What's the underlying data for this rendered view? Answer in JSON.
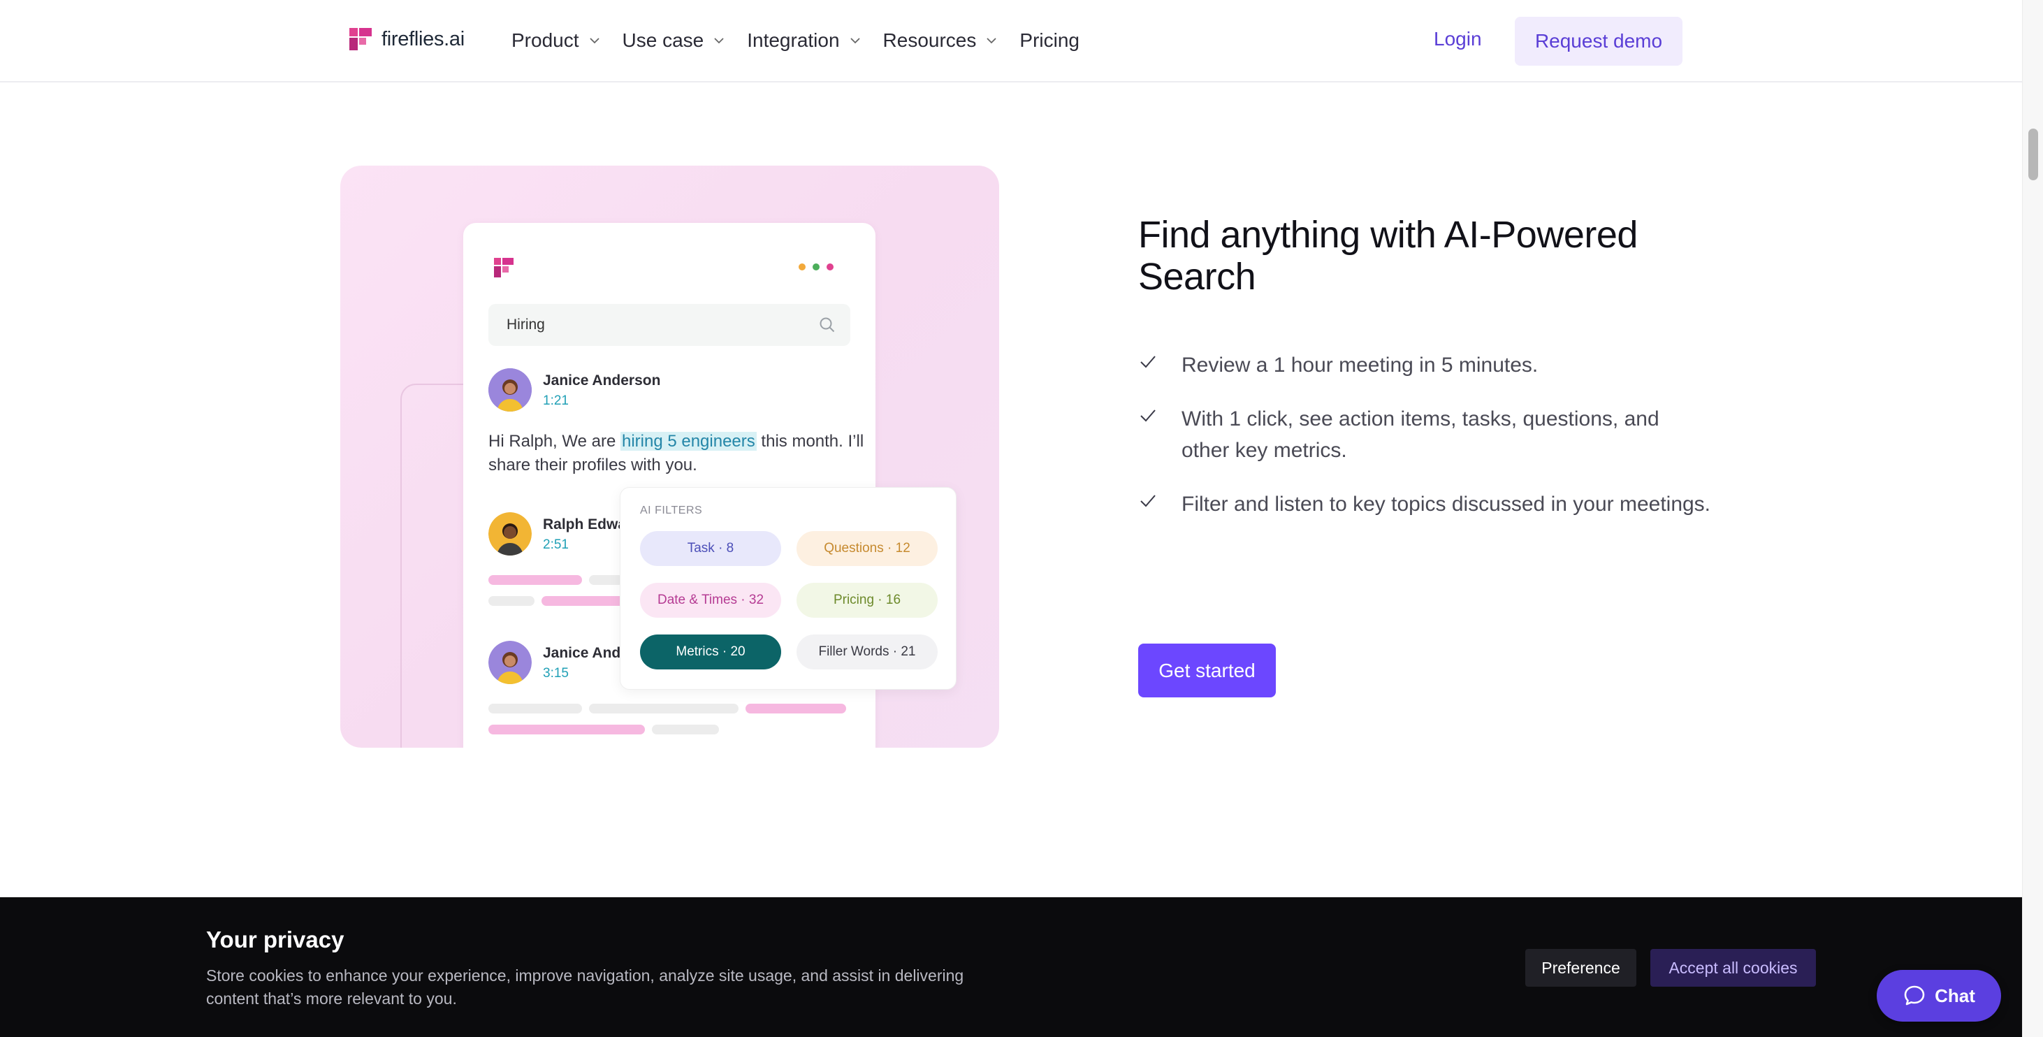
{
  "header": {
    "brand": "fireflies.ai",
    "nav": [
      {
        "label": "Product",
        "has_dropdown": true
      },
      {
        "label": "Use case",
        "has_dropdown": true
      },
      {
        "label": "Integration",
        "has_dropdown": true
      },
      {
        "label": "Resources",
        "has_dropdown": true
      },
      {
        "label": "Pricing",
        "has_dropdown": false
      }
    ],
    "login_label": "Login",
    "demo_label": "Request demo"
  },
  "illustration": {
    "search_value": "Hiring",
    "messages": [
      {
        "name": "Janice Anderson",
        "time": "1:21"
      },
      {
        "name": "Ralph Edwa",
        "time": "2:51"
      },
      {
        "name": "Janice And",
        "time": "3:15"
      }
    ],
    "message_before": "Hi Ralph, We are ",
    "message_highlight": "hiring 5 engineers",
    "message_after": " this month. I’ll share their profiles with you.",
    "filters_title": "AI FILTERS",
    "filters": [
      {
        "label": "Task · 8",
        "bg": "#e8e8fb",
        "fg": "#4c4fb8"
      },
      {
        "label": "Questions · 12",
        "bg": "#fdf0e1",
        "fg": "#c68a2f"
      },
      {
        "label": "Date & Times · 32",
        "bg": "#fbe6f4",
        "fg": "#b53b93"
      },
      {
        "label": "Pricing · 16",
        "bg": "#f2f7e6",
        "fg": "#6d8a2b"
      },
      {
        "label": "Metrics · 20",
        "bg": "#0c6467",
        "fg": "#ffffff"
      },
      {
        "label": "Filler Words · 21",
        "bg": "#f2f2f4",
        "fg": "#3a3a44"
      }
    ],
    "dot_colors": [
      "#f2a93b",
      "#4cae5b",
      "#e0418f"
    ]
  },
  "section": {
    "heading": "Find anything with AI-Powered Search",
    "features": [
      "Review a 1 hour meeting in 5 minutes.",
      "With 1 click, see action items, tasks, questions, and other key metrics.",
      "Filter and listen to key topics discussed in your meetings."
    ],
    "cta_label": "Get started"
  },
  "cookie": {
    "title": "Your privacy",
    "text": "Store cookies to enhance your experience, improve navigation, analyze site usage, and assist in delivering content that’s more relevant to you.",
    "preference_label": "Preference",
    "accept_label": "Accept all cookies"
  },
  "chat": {
    "label": "Chat"
  },
  "colors": {
    "accent": "#6c47ff",
    "brand_pink": "#d6338e"
  }
}
